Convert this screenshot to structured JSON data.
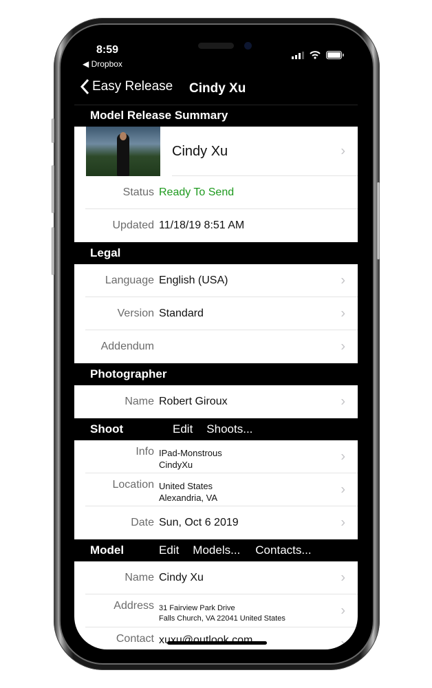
{
  "status_bar": {
    "time": "8:59",
    "back_app": "Dropbox"
  },
  "nav": {
    "back_label": "Easy Release",
    "title": "Cindy Xu"
  },
  "summary": {
    "header": "Model Release Summary",
    "name": "Cindy Xu",
    "rows": [
      {
        "label": "Status",
        "value": "Ready To Send",
        "color": "#1e9a1e"
      },
      {
        "label": "Updated",
        "value": "11/18/19 8:51 AM"
      }
    ]
  },
  "legal": {
    "header": "Legal",
    "rows": [
      {
        "label": "Language",
        "value": "English (USA)"
      },
      {
        "label": "Version",
        "value": "Standard"
      },
      {
        "label": "Addendum",
        "value": ""
      }
    ]
  },
  "photographer": {
    "header": "Photographer",
    "rows": [
      {
        "label": "Name",
        "value": "Robert Giroux"
      }
    ]
  },
  "shoot": {
    "header": "Shoot",
    "edit": "Edit",
    "list": "Shoots...",
    "rows": [
      {
        "label": "Info",
        "line1": "IPad-Monstrous",
        "line2": "CindyXu"
      },
      {
        "label": "Location",
        "line1": "United States",
        "line2": "Alexandria, VA"
      },
      {
        "label": "Date",
        "value": "Sun, Oct 6 2019"
      }
    ]
  },
  "model": {
    "header": "Model",
    "edit": "Edit",
    "list": "Models...",
    "contacts": "Contacts...",
    "rows": [
      {
        "label": "Name",
        "value": "Cindy Xu"
      },
      {
        "label": "Address",
        "line1": "31 Fairview Park Drive",
        "line2": "Falls Church, VA 22041 United States"
      },
      {
        "label": "Contact",
        "value": "xuxu@outlook.com"
      }
    ]
  }
}
